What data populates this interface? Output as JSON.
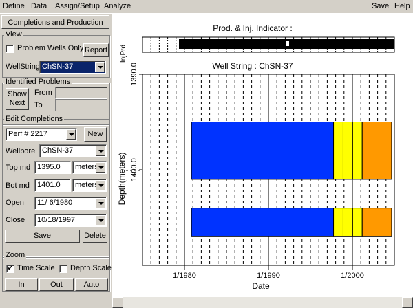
{
  "menu": {
    "left": [
      "Define",
      "Data",
      "Assign/Setup",
      "Analyze"
    ],
    "right": [
      "Save",
      "Help"
    ]
  },
  "panel": {
    "tab_label": "Completions and Production",
    "view": {
      "title": "View",
      "problem_wells_label": "Problem Wells Only",
      "problem_wells_checked": false,
      "report_button": "Report",
      "wellstring_label": "WellString",
      "wellstring_value": "ChSN-37"
    },
    "problems": {
      "title": "Identified Problems",
      "show_next_line1": "Show",
      "show_next_line2": "Next",
      "from_label": "From",
      "to_label": "To"
    },
    "edit": {
      "title": "Edit Completions",
      "perf_value": "Perf #  2217",
      "new_button": "New",
      "wellbore_label": "Wellbore",
      "wellbore_value": "ChSN-37",
      "top_label": "Top md",
      "top_value": "1395.0",
      "top_unit": "meters",
      "bot_label": "Bot md",
      "bot_value": "1401.0",
      "bot_unit": "meters",
      "open_label": "Open",
      "open_value": "11/ 6/1980",
      "close_label": "Close",
      "close_value": "10/18/1997",
      "save_button": "Save",
      "delete_button": "Delete"
    },
    "zoom": {
      "title": "Zoom",
      "time_scale_label": "Time Scale",
      "time_scale_checked": true,
      "depth_scale_label": "Depth Scale",
      "depth_scale_checked": false,
      "in_button": "In",
      "out_button": "Out",
      "auto_button": "Auto"
    }
  },
  "chart_data": {
    "type": "timeline",
    "indicator": {
      "title": "Prod. & Inj. Indicator :",
      "ylabel": "InjPrd"
    },
    "main": {
      "title": "Well String : ChSN-37",
      "xlabel": "Date",
      "ylabel": "Depth(meters)",
      "x_ticks": [
        "1/1980",
        "1/1990",
        "1/2000"
      ],
      "y_ticks": [
        "1390.0",
        "1400.0"
      ],
      "xlim": [
        "1975-01",
        "2004-12"
      ],
      "ylim": [
        1390.0,
        1410.0
      ],
      "intervals": [
        {
          "top": 1395.0,
          "bottom": 1401.0,
          "segments": [
            {
              "start": "1980-11",
              "end": "1997-10",
              "color": "#0033ff"
            },
            {
              "start": "1997-10",
              "end": "2001-03",
              "color": "#ffff00"
            },
            {
              "start": "2001-03",
              "end": "2004-09",
              "color": "#ff9900"
            }
          ]
        },
        {
          "top": 1404.0,
          "bottom": 1407.0,
          "segments": [
            {
              "start": "1980-11",
              "end": "1997-10",
              "color": "#0033ff"
            },
            {
              "start": "1997-10",
              "end": "2001-03",
              "color": "#ffff00"
            },
            {
              "start": "2001-03",
              "end": "2004-09",
              "color": "#ff9900"
            }
          ]
        }
      ]
    }
  }
}
